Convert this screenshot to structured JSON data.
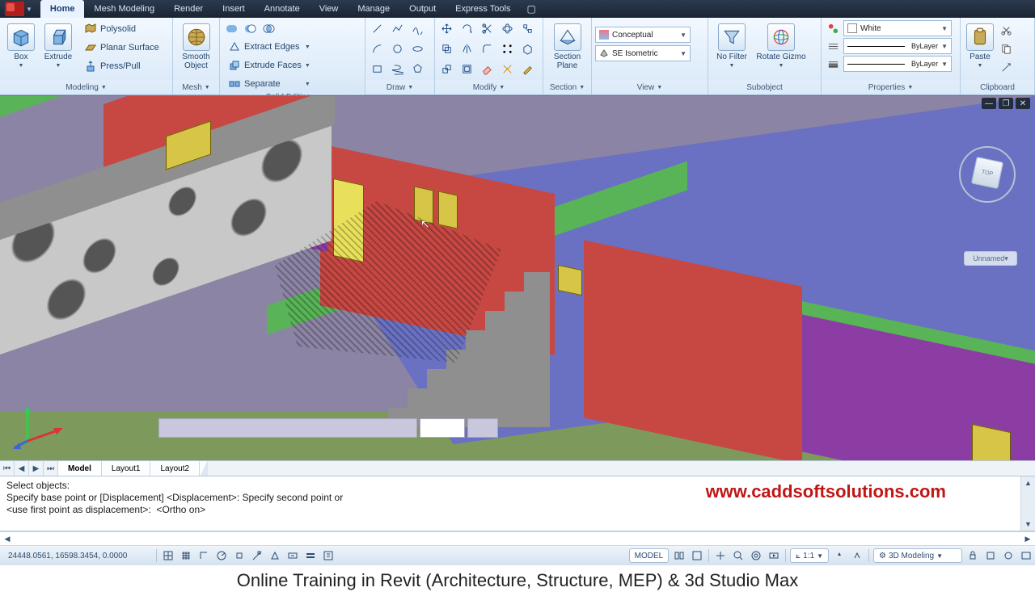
{
  "menu": {
    "tabs": [
      "Home",
      "Mesh Modeling",
      "Render",
      "Insert",
      "Annotate",
      "View",
      "Manage",
      "Output",
      "Express Tools"
    ],
    "active": 0
  },
  "ribbon": {
    "modeling": {
      "title": "Modeling",
      "box": "Box",
      "extrude": "Extrude",
      "polysolid": "Polysolid",
      "planar": "Planar Surface",
      "presspull": "Press/Pull"
    },
    "mesh": {
      "title": "Mesh",
      "smooth": "Smooth\nObject"
    },
    "solid": {
      "title": "Solid Editing",
      "extract": "Extract Edges",
      "extrudef": "Extrude Faces",
      "separate": "Separate"
    },
    "draw": {
      "title": "Draw"
    },
    "modify": {
      "title": "Modify"
    },
    "section": {
      "title": "Section",
      "plane": "Section\nPlane"
    },
    "view": {
      "title": "View",
      "style": "Conceptual",
      "proj": "SE Isometric"
    },
    "subobject": {
      "title": "Subobject",
      "filter": "No Filter",
      "gizmo": "Rotate Gizmo"
    },
    "properties": {
      "title": "Properties",
      "color": "White",
      "bylayer": "ByLayer"
    },
    "clipboard": {
      "title": "Clipboard",
      "paste": "Paste"
    }
  },
  "viewport": {
    "unnamed": "Unnamed",
    "cubetop": "TOP"
  },
  "layouts": {
    "tabs": [
      "Model",
      "Layout1",
      "Layout2"
    ],
    "active": 0
  },
  "command": {
    "l1": "Select objects:",
    "l2": "Specify base point or [Displacement] <Displacement>: Specify second point or",
    "l3": "<use first point as displacement>:  <Ortho on>",
    "watermark": "www.caddsoftsolutions.com"
  },
  "status": {
    "coords": "24448.0561, 16598.3454, 0.0000",
    "model": "MODEL",
    "scale": "1:1",
    "workspace": "3D Modeling"
  },
  "footer": "Online Training in Revit (Architecture, Structure, MEP) & 3d Studio Max"
}
